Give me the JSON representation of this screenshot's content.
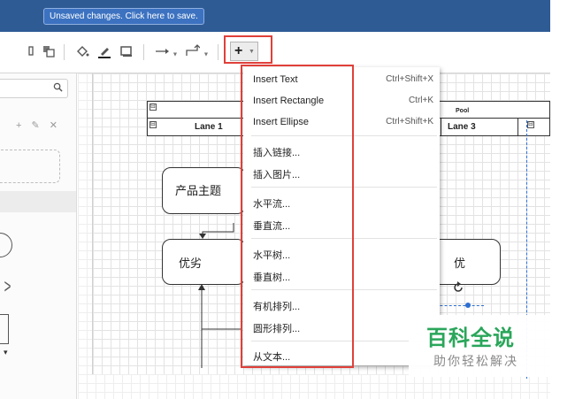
{
  "banner": {
    "unsaved_text": "Unsaved changes. Click here to save."
  },
  "toolbar": {
    "icons": [
      "delete-icon",
      "to-back-icon",
      "fill-color-icon",
      "line-color-icon",
      "shadow-icon",
      "connection-icon",
      "waypoints-icon",
      "insert-icon"
    ],
    "insert_label": "+",
    "caret_glyph": "▼"
  },
  "sidebar": {
    "search": {
      "placeholder": "",
      "value": ""
    },
    "actions": "+ ✎ ✕"
  },
  "diagram": {
    "pool_label": "Pool",
    "lanes": [
      "Lane 1",
      "Lane 3"
    ],
    "nodes": {
      "topic": "产品主题",
      "merit": "优劣",
      "good": "优"
    },
    "collapse_glyph": "⊟"
  },
  "insert_menu": {
    "items": [
      {
        "label": "Insert Text",
        "shortcut": "Ctrl+Shift+X"
      },
      {
        "label": "Insert Rectangle",
        "shortcut": "Ctrl+K"
      },
      {
        "label": "Insert Ellipse",
        "shortcut": "Ctrl+Shift+K"
      },
      {
        "label": "插入链接...",
        "shortcut": ""
      },
      {
        "label": "插入图片...",
        "shortcut": ""
      },
      {
        "label": "水平流...",
        "shortcut": ""
      },
      {
        "label": "垂直流...",
        "shortcut": ""
      },
      {
        "label": "水平树...",
        "shortcut": ""
      },
      {
        "label": "垂直树...",
        "shortcut": ""
      },
      {
        "label": "有机排列...",
        "shortcut": ""
      },
      {
        "label": "圆形排列...",
        "shortcut": ""
      },
      {
        "label": "从文本...",
        "shortcut": ""
      }
    ]
  },
  "watermark": {
    "title": "百科全说",
    "subtitle": "助你轻松解决"
  },
  "colors": {
    "topbar": "#2f5b95",
    "banner": "#3c72c0",
    "highlight_red": "#e0403a",
    "selection_blue": "#2d6fd0",
    "watermark_green": "#2aa65a"
  }
}
